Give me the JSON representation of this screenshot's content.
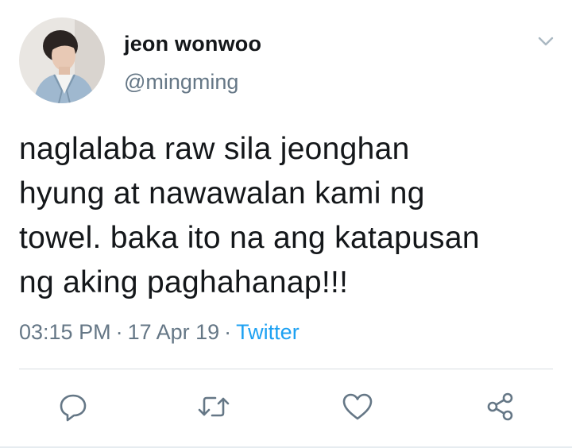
{
  "user": {
    "display_name": "jeon wonwoo",
    "handle": "@mingming",
    "avatar": "profile-photo"
  },
  "tweet": {
    "lines": [
      "naglalaba raw sila jeonghan",
      "hyung at nawawalan kami ng",
      "towel. baka ito na ang katapusan",
      "ng aking paghahanap!!!"
    ],
    "time": "03:15 PM",
    "date": "17 Apr 19",
    "separator": "·",
    "source": "Twitter"
  },
  "actions": {
    "icons": [
      "reply-icon",
      "retweet-icon",
      "like-icon",
      "share-icon"
    ]
  },
  "colors": {
    "text": "#14171a",
    "secondary": "#657786",
    "link": "#1da1f2",
    "icon": "#657786"
  }
}
